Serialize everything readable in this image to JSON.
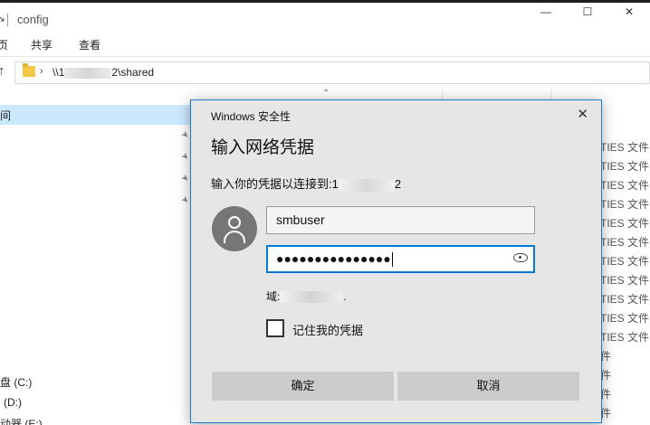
{
  "explorer": {
    "window_title": "config",
    "title_icon": "↘",
    "ribbon_tabs": [
      "页",
      "共享",
      "查看"
    ],
    "address_prefix": "\\\\1",
    "address_suffix": "2\\shared",
    "nav_selected": "间",
    "drives": [
      "盘 (C:)",
      "(D:)",
      "动器 (E:)"
    ],
    "type_cells": [
      "TIES 文件",
      "TIES 文件",
      "TIES 文件",
      "TIES 文件",
      "TIES 文件",
      "TIES 文件",
      "TIES 文件",
      "TIES 文件",
      "TIES 文件",
      "TIES 文件",
      "TIES 文件",
      "件",
      "件",
      "件",
      "件",
      "件"
    ],
    "window_buttons": [
      "—",
      "☐",
      "✕"
    ]
  },
  "dialog": {
    "caption": "Windows 安全性",
    "close_glyph": "✕",
    "heading": "输入网络凭据",
    "subtitle_prefix": "输入你的凭据以连接到:1",
    "subtitle_suffix": "2",
    "username": "smbuser",
    "password_mask": "●●●●●●●●●●●●●●●",
    "domain_label": "域:",
    "domain_suffix": ".",
    "remember_label": "记住我的凭据",
    "ok_label": "确定",
    "cancel_label": "取消"
  },
  "colors": {
    "accent": "#0078d7",
    "dialog_bg": "#e6e6e6",
    "button_bg": "#cccccc",
    "selection": "#cce8ff"
  }
}
